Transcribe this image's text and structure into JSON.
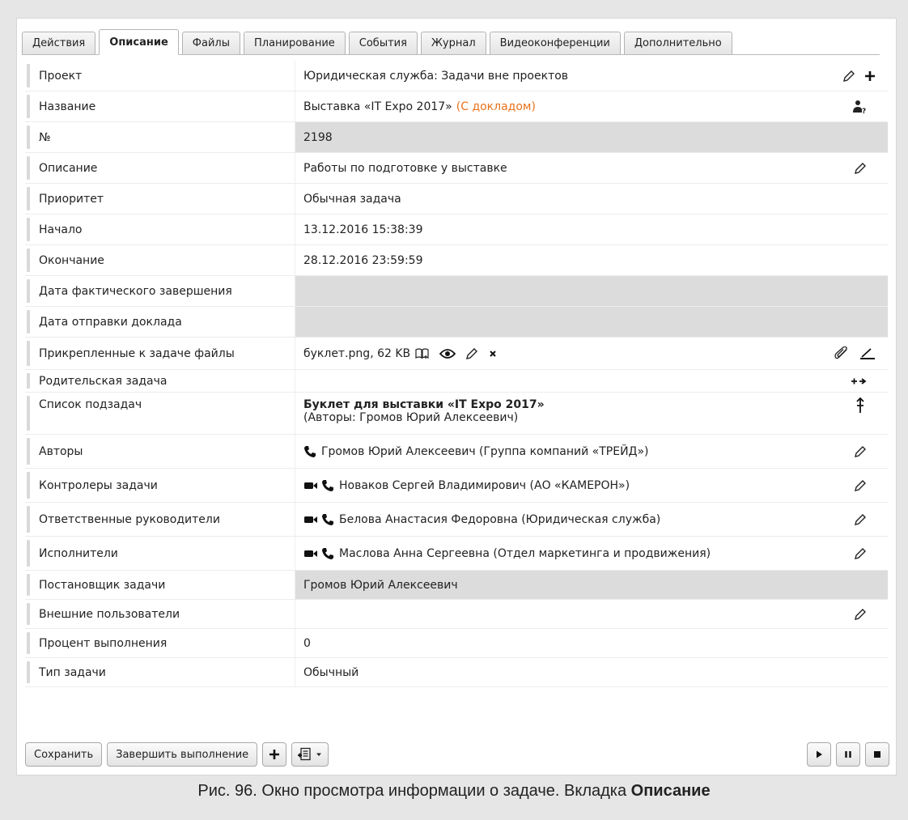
{
  "tabs": [
    {
      "label": "Действия"
    },
    {
      "label": "Описание"
    },
    {
      "label": "Файлы"
    },
    {
      "label": "Планирование"
    },
    {
      "label": "События"
    },
    {
      "label": "Журнал"
    },
    {
      "label": "Видеоконференции"
    },
    {
      "label": "Дополнительно"
    }
  ],
  "active_tab": "Описание",
  "rows": {
    "project": {
      "label": "Проект",
      "value": "Юридическая служба: Задачи вне проектов"
    },
    "name": {
      "label": "Название",
      "value": "Выставка «IT Expo 2017»",
      "status": "(С докладом)"
    },
    "number": {
      "label": "№",
      "value": "2198"
    },
    "description": {
      "label": "Описание",
      "value": "Работы по подготовке у выставке"
    },
    "priority": {
      "label": "Приоритет",
      "value": "Обычная задача"
    },
    "start": {
      "label": "Начало",
      "value": "13.12.2016 15:38:39"
    },
    "end": {
      "label": "Окончание",
      "value": "28.12.2016 23:59:59"
    },
    "actual_end": {
      "label": "Дата фактического завершения",
      "value": ""
    },
    "report_date": {
      "label": "Дата отправки доклада",
      "value": ""
    },
    "files": {
      "label": "Прикрепленные к задаче файлы",
      "value": "буклет.png, 62 KB"
    },
    "parent": {
      "label": "Родительская задача",
      "value": ""
    },
    "subtasks": {
      "label": "Список подзадач",
      "title": "Буклет для выставки «IT Expo 2017»",
      "authors": "(Авторы: Громов Юрий Алексеевич)"
    },
    "authors": {
      "label": "Авторы",
      "value": "Громов Юрий Алексеевич (Группа компаний «ТРЕЙД»)"
    },
    "controllers": {
      "label": "Контролеры задачи",
      "value": "Новаков Сергей Владимирович (АО «КАМЕРОН»)"
    },
    "managers": {
      "label": "Ответственные руководители",
      "value": "Белова Анастасия Федоровна (Юридическая служба)"
    },
    "executors": {
      "label": "Исполнители",
      "value": "Маслова Анна Сергеевна (Отдел маркетинга и продвижения)"
    },
    "setter": {
      "label": "Постановщик задачи",
      "value": "Громов Юрий Алексеевич"
    },
    "external": {
      "label": "Внешние пользователи",
      "value": ""
    },
    "percent": {
      "label": "Процент выполнения",
      "value": "0"
    },
    "type": {
      "label": "Тип задачи",
      "value": "Обычный"
    }
  },
  "toolbar": {
    "save_label": "Сохранить",
    "complete_label": "Завершить выполнение"
  },
  "caption": {
    "text": "Рис. 96. Окно просмотра информации о задаче. Вкладка ",
    "bold": "Описание"
  },
  "icons": {
    "edit": "pencil-icon",
    "add": "plus-icon",
    "role": "person-question-icon",
    "attach": "paperclip-icon",
    "scan": "scanner-icon",
    "parent_link": "link-arrow-icon",
    "subtask_move": "updown-arrow-icon",
    "phone": "phone-icon",
    "video": "video-icon",
    "view": "eye-icon",
    "open": "book-icon",
    "delete": "close-icon"
  },
  "colors": {
    "status_orange": "#e8731b",
    "shaded_row": "#dcdcdc",
    "background": "#e6e6e6"
  }
}
